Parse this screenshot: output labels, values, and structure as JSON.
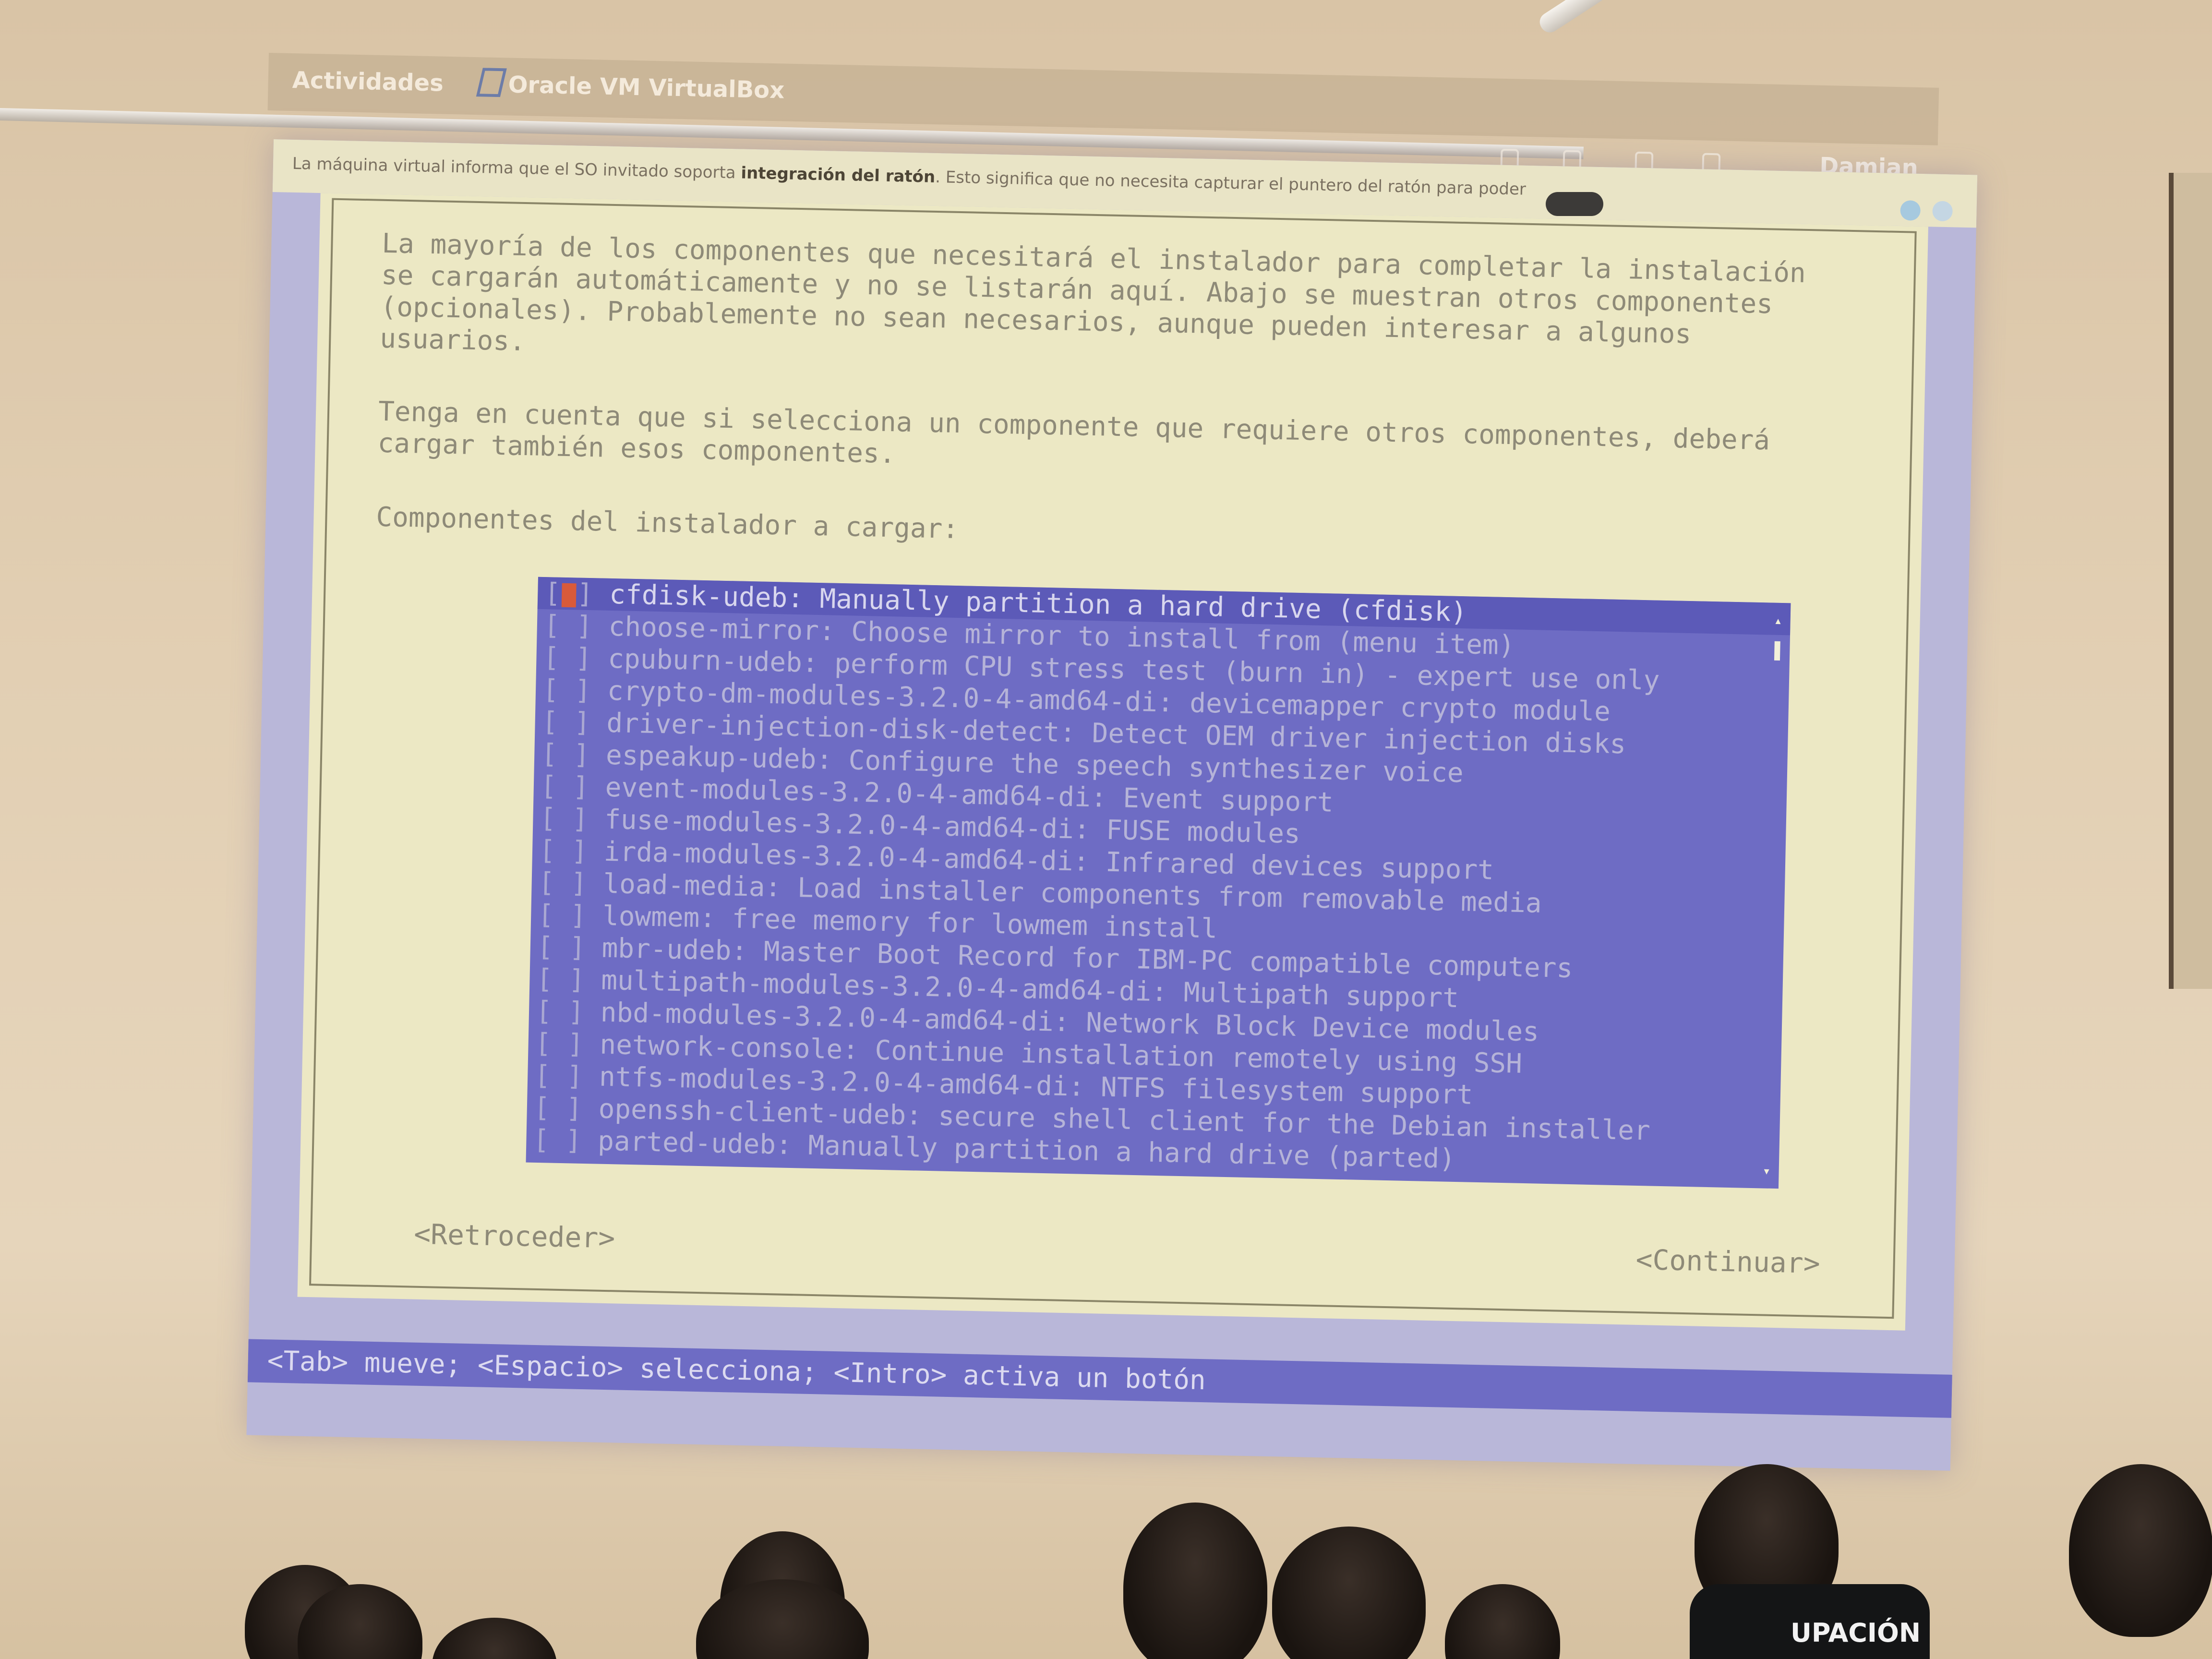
{
  "gnome_bar": {
    "activities_label": "Actividades",
    "app_name": "Oracle VM VirtualBox",
    "user_name": "Damian"
  },
  "vbox_notice": {
    "text_before": "La máquina virtual informa que el SO invitado soporta ",
    "text_bold": "integración del ratón",
    "text_after": ". Esto significa que no necesita capturar el puntero del ratón para poder"
  },
  "installer": {
    "intro": "La mayoría de los componentes que necesitará el instalador para completar la instalación\nse cargarán automáticamente y no se listarán aquí. Abajo se muestran otros componentes\n(opcionales). Probablemente no sean necesarios, aunque pueden interesar a algunos\nusuarios.",
    "note": "Tenga en cuenta que si selecciona un componente que requiere otros componentes, deberá\ncargar también esos componentes.",
    "prompt": "Componentes del instalador a cargar:",
    "components": [
      "cfdisk-udeb: Manually partition a hard drive (cfdisk)",
      "choose-mirror: Choose mirror to install from (menu item)",
      "cpuburn-udeb: perform CPU stress test (burn in) - expert use only",
      "crypto-dm-modules-3.2.0-4-amd64-di: devicemapper crypto module",
      "driver-injection-disk-detect: Detect OEM driver injection disks",
      "espeakup-udeb: Configure the speech synthesizer voice",
      "event-modules-3.2.0-4-amd64-di: Event support",
      "fuse-modules-3.2.0-4-amd64-di: FUSE modules",
      "irda-modules-3.2.0-4-amd64-di: Infrared devices support",
      "load-media: Load installer components from removable media",
      "lowmem: free memory for lowmem install",
      "mbr-udeb: Master Boot Record for IBM-PC compatible computers",
      "multipath-modules-3.2.0-4-amd64-di: Multipath support",
      "nbd-modules-3.2.0-4-amd64-di: Network Block Device modules",
      "network-console: Continue installation remotely using SSH",
      "ntfs-modules-3.2.0-4-amd64-di: NTFS filesystem support",
      "openssh-client-udeb: secure shell client for the Debian installer",
      "parted-udeb: Manually partition a hard drive (parted)"
    ],
    "checkbox_empty": "[ ]",
    "back_button": "<Retroceder>",
    "continue_button": "<Continuar>",
    "status_bar": "<Tab> mueve; <Espacio> selecciona; <Intro> activa un botón"
  },
  "audience": {
    "shirt_text": "UPACIÓN"
  }
}
